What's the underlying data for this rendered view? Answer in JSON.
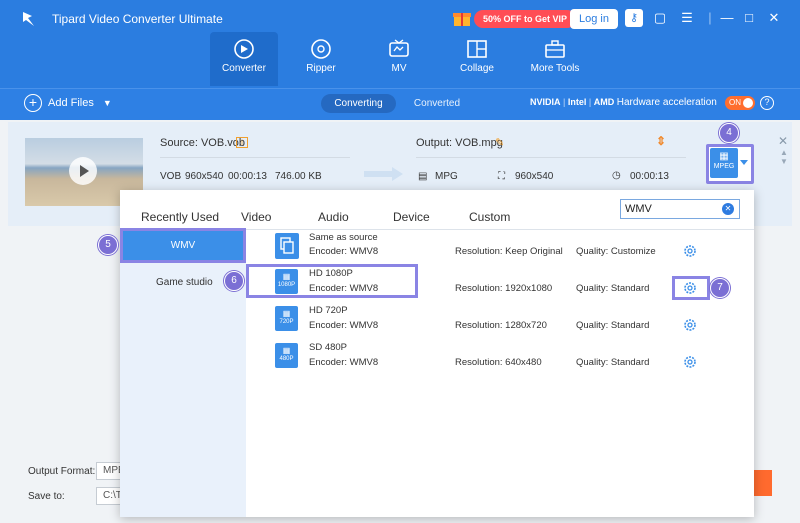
{
  "app": {
    "title": "Tipard Video Converter Ultimate"
  },
  "header": {
    "promo": "50% OFF to Get VIP",
    "login": "Log in",
    "tabs": [
      {
        "label": "Converter",
        "icon": "converter-icon",
        "active": true
      },
      {
        "label": "Ripper",
        "icon": "ripper-disc-icon"
      },
      {
        "label": "MV",
        "icon": "mv-tv-icon"
      },
      {
        "label": "Collage",
        "icon": "collage-grid-icon"
      },
      {
        "label": "More Tools",
        "icon": "toolbox-icon"
      }
    ]
  },
  "toolbar": {
    "add_files": "Add Files",
    "converting": "Converting",
    "converted": "Converted",
    "nvidia": "NVIDIA",
    "intel": "Intel",
    "amd": "AMD",
    "hw_label": "Hardware acceleration",
    "toggle": "ON"
  },
  "file": {
    "source": "Source: VOB.vob",
    "src_format": "VOB",
    "src_res": "960x540",
    "src_duration": "00:00:13",
    "src_size": "746.00 KB",
    "output": "Output: VOB.mpg",
    "out_format": "MPG",
    "out_res": "960x540",
    "out_duration": "00:00:13",
    "format_badge": "MPEG"
  },
  "callouts": {
    "c4": "4",
    "c5": "5",
    "c6": "6",
    "c7": "7"
  },
  "panel": {
    "tabs": [
      "Recently Used",
      "Video",
      "Audio",
      "Device",
      "Custom"
    ],
    "search": "WMV",
    "sidebar": [
      "WMV",
      "Game studio"
    ],
    "presets": [
      {
        "name": "Same as source",
        "encoder": "Encoder: WMV8",
        "resolution": "Resolution: Keep Original",
        "quality": "Quality: Customize",
        "badge": ""
      },
      {
        "name": "HD 1080P",
        "encoder": "Encoder: WMV8",
        "resolution": "Resolution: 1920x1080",
        "quality": "Quality: Standard",
        "badge": "1080P"
      },
      {
        "name": "HD 720P",
        "encoder": "Encoder: WMV8",
        "resolution": "Resolution: 1280x720",
        "quality": "Quality: Standard",
        "badge": "720P"
      },
      {
        "name": "SD 480P",
        "encoder": "Encoder: WMV8",
        "resolution": "Resolution: 640x480",
        "quality": "Quality: Standard",
        "badge": "480P"
      }
    ]
  },
  "bottom": {
    "output_format_label": "Output Format:",
    "output_format_value": "MPE",
    "save_to_label": "Save to:",
    "save_to_value": "C:\\T"
  },
  "colors": {
    "titlebar": "#2b7de0",
    "accent": "#3b8fe8",
    "callout": "#7b6fd4",
    "promo": "#ff4d55",
    "toggle": "#ff6e2e"
  }
}
